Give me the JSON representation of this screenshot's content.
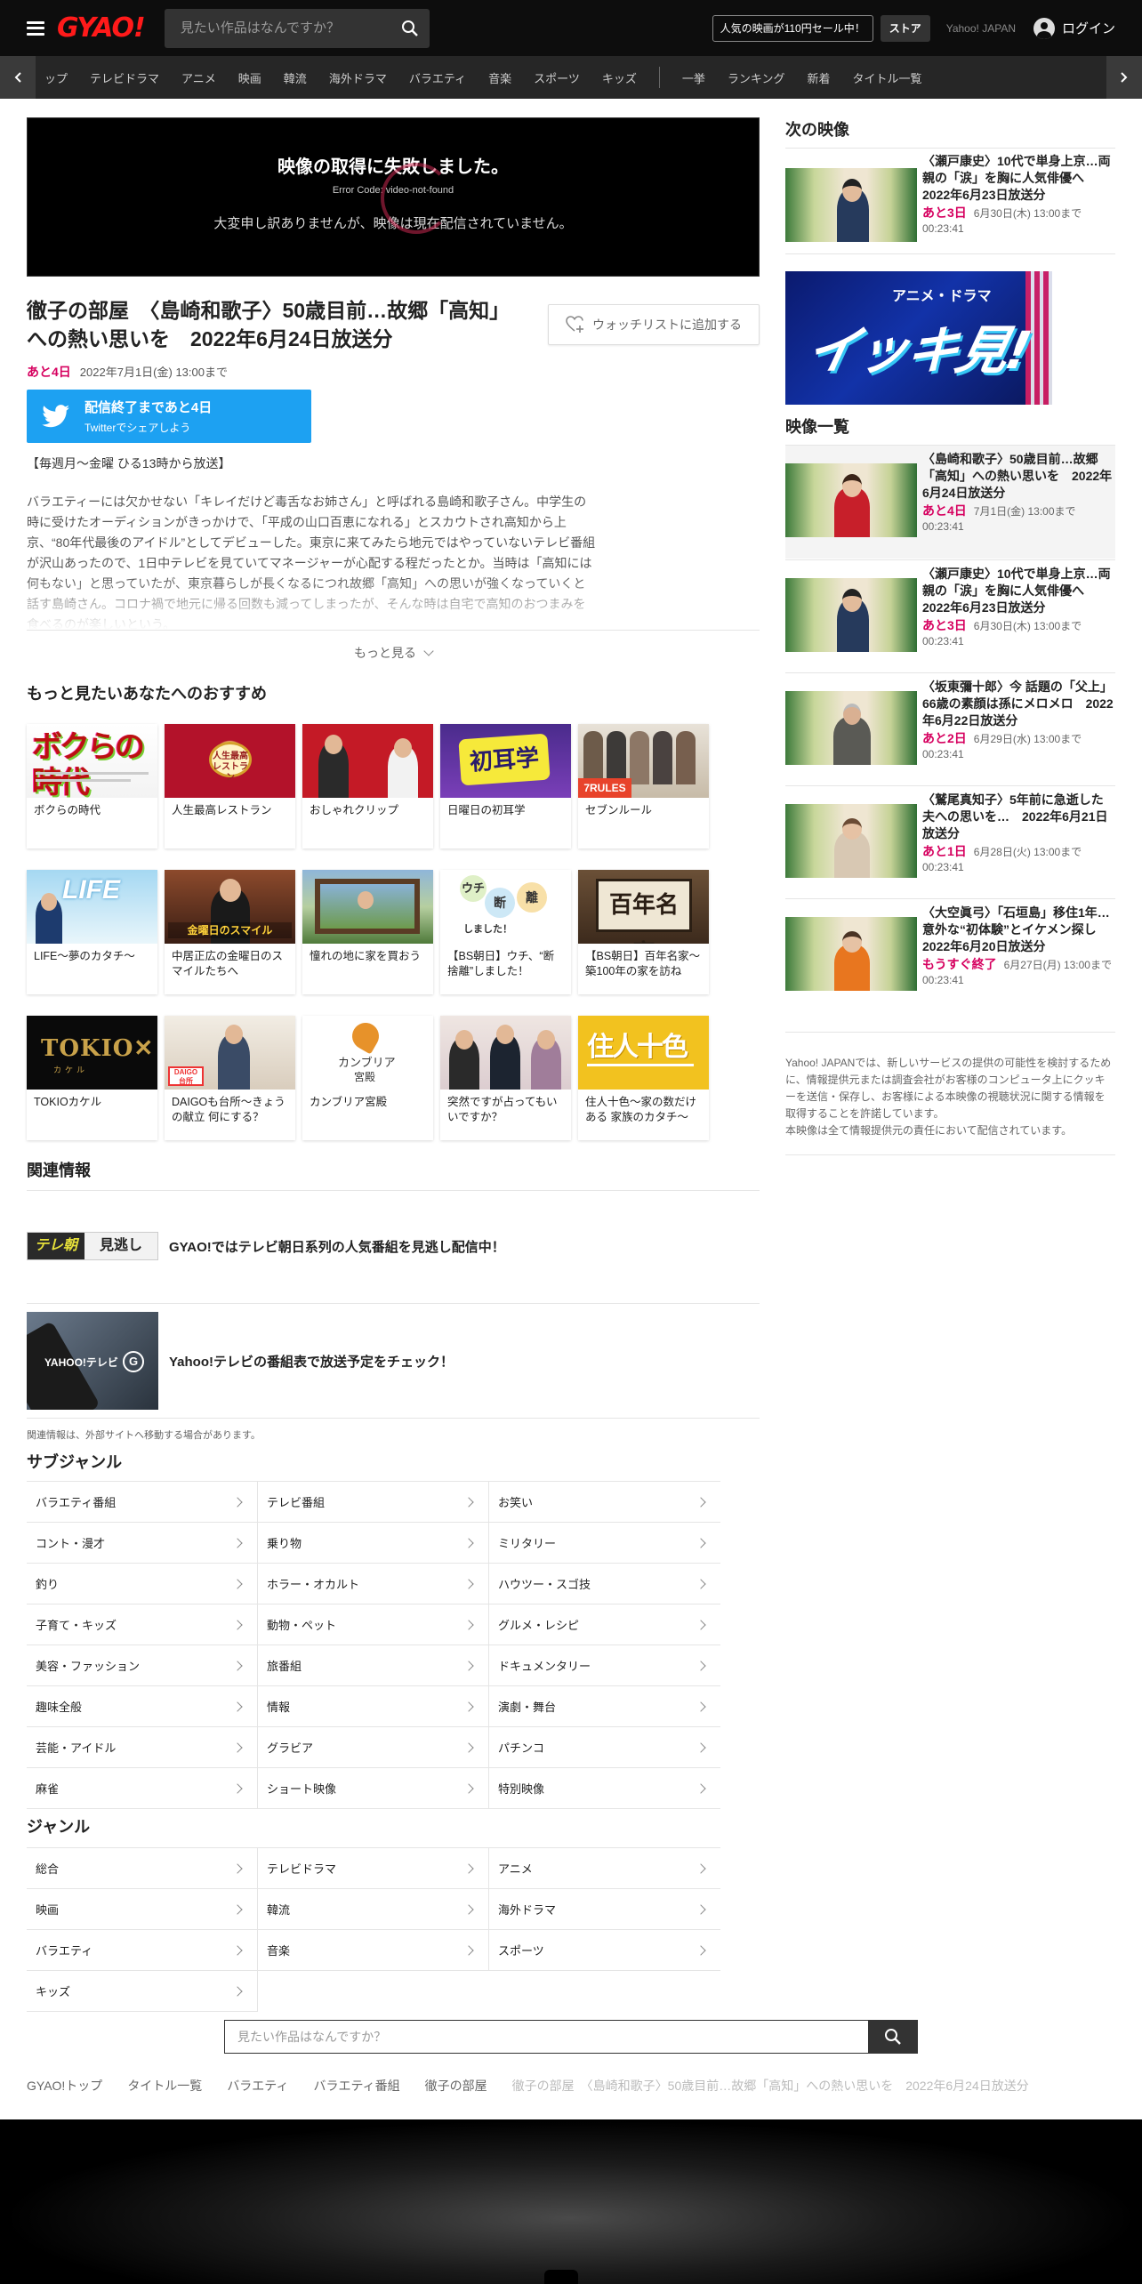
{
  "header": {
    "logo": "GYAO!",
    "search_placeholder": "見たい作品はなんですか？",
    "promo": "人気の映画が110円セール中！",
    "store": "ストア",
    "yahoo": "Yahoo! JAPAN",
    "login": "ログイン"
  },
  "nav": [
    "ップ",
    "テレビドラマ",
    "アニメ",
    "映画",
    "韓流",
    "海外ドラマ",
    "バラエティ",
    "音楽",
    "スポーツ",
    "キッズ",
    "一挙",
    "ランキング",
    "新着",
    "タイトル一覧"
  ],
  "player": {
    "error_title": "映像の取得に失敗しました。",
    "error_code": "Error Code: video-not-found",
    "error_message": "大変申し訳ありませんが、映像は現在配信されていません。"
  },
  "episode": {
    "title": "徹子の部屋　〈島崎和歌子〉50歳目前…故郷「高知」への熱い思いを　2022年6月24日放送分",
    "watchlist": "ウォッチリストに追加する",
    "remaining": "あと4日",
    "deadline": "2022年7月1日(金) 13:00まで",
    "twitter_main": "配信終了まであと4日",
    "twitter_sub": "Twitterでシェアしよう",
    "broadcast": "【毎週月～金曜 ひる13時から放送】",
    "description": "バラエティーには欠かせない「キレイだけど毒舌なお姉さん」と呼ばれる島崎和歌子さん。中学生の時に受けたオーディションがきっかけで、「平成の山口百恵になれる」とスカウトされ高知から上京、“80年代最後のアイドル”としてデビューした。東京に来てみたら地元ではやっていないテレビ番組が沢山あったので、1日中テレビを見ていてマネージャーが心配する程だったとか。当時は「高知には何もない」と思っていたが、東京暮らしが長くなるにつれ故郷「高知」への思いが強くなっていくと話す島崎さん。コロナ禍で地元に帰る回数も減ってしまったが、そんな時は自宅で高知のおつまみを食べるのが楽しいという。",
    "more": "もっと見る"
  },
  "recommend": {
    "heading": "もっと見たいあなたへのおすすめ",
    "items": [
      {
        "label": "ボクらの時代"
      },
      {
        "label": "人生最高レストラン"
      },
      {
        "label": "おしゃれクリップ"
      },
      {
        "label": "日曜日の初耳学"
      },
      {
        "label": "セブンルール"
      },
      {
        "label": "LIFE～夢のカタチ～"
      },
      {
        "label": "中居正広の金曜日のスマイルたちへ"
      },
      {
        "label": "憧れの地に家を買おう"
      },
      {
        "label": "【BS朝日】ウチ、“断捨離”しました！"
      },
      {
        "label": "【BS朝日】百年名家～築100年の家を訪ね"
      },
      {
        "label": "TOKIOカケル"
      },
      {
        "label": "DAIGOも台所～きょうの献立 何にする？"
      },
      {
        "label": "カンブリア宮殿"
      },
      {
        "label": "突然ですが占ってもいいですか？"
      },
      {
        "label": "住人十色～家の数だけある 家族のカタチ～"
      }
    ]
  },
  "related": {
    "heading": "関連情報",
    "items": [
      {
        "text": "GYAO!ではテレビ朝日系列の人気番組を見逃し配信中！",
        "badge": "テレ朝",
        "badge2": "見逃し"
      },
      {
        "text": "Yahoo!テレビの番組表で放送予定をチェック！",
        "badge": "YAHOO!テレビ",
        "badge2": "G"
      }
    ],
    "note": "関連情報は、外部サイトへ移動する場合があります。"
  },
  "subgenre": {
    "heading": "サブジャンル",
    "items": [
      "バラエティ番組",
      "テレビ番組",
      "お笑い",
      "コント・漫才",
      "乗り物",
      "ミリタリー",
      "釣り",
      "ホラー・オカルト",
      "ハウツー・スゴ技",
      "子育て・キッズ",
      "動物・ペット",
      "グルメ・レシピ",
      "美容・ファッション",
      "旅番組",
      "ドキュメンタリー",
      "趣味全般",
      "情報",
      "演劇・舞台",
      "芸能・アイドル",
      "グラビア",
      "パチンコ",
      "麻雀",
      "ショート映像",
      "特別映像"
    ]
  },
  "genre": {
    "heading": "ジャンル",
    "items": [
      "総合",
      "テレビドラマ",
      "アニメ",
      "映画",
      "韓流",
      "海外ドラマ",
      "バラエティ",
      "音楽",
      "スポーツ",
      "キッズ"
    ]
  },
  "footer_search_placeholder": "見たい作品はなんですか？",
  "breadcrumbs": [
    "GYAO!トップ",
    "タイトル一覧",
    "バラエティ",
    "バラエティ番組",
    "徹子の部屋",
    "徹子の部屋　〈島崎和歌子〉50歳目前…故郷「高知」への熱い思いを　2022年6月24日放送分"
  ],
  "sidebar": {
    "next_heading": "次の映像",
    "next": {
      "title": "〈瀬戸康史〉10代で単身上京…両親の「涙」を胸に人気俳優へ　2022年6月23日放送分",
      "remaining": "あと3日",
      "deadline": "6月30日(木) 13:00まで",
      "duration": "00:23:41"
    },
    "banner_small": "アニメ・ドラマ",
    "banner_big": "イッキ見!",
    "list_heading": "映像一覧",
    "list": [
      {
        "title": "〈島崎和歌子〉50歳目前…故郷「高知」への熱い思いを　2022年6月24日放送分",
        "remaining": "あと4日",
        "deadline": "7月1日(金) 13:00まで",
        "duration": "00:23:41"
      },
      {
        "title": "〈瀬戸康史〉10代で単身上京…両親の「涙」を胸に人気俳優へ　2022年6月23日放送分",
        "remaining": "あと3日",
        "deadline": "6月30日(木) 13:00まで",
        "duration": "00:23:41"
      },
      {
        "title": "〈坂東彌十郎〉今 話題の「父上」66歳の素顔は孫にメロメロ　2022年6月22日放送分",
        "remaining": "あと2日",
        "deadline": "6月29日(水) 13:00まで",
        "duration": "00:23:41"
      },
      {
        "title": "〈鷲尾真知子〉5年前に急逝した夫への思いを…　2022年6月21日放送分",
        "remaining": "あと1日",
        "deadline": "6月28日(火) 13:00まで",
        "duration": "00:23:41"
      },
      {
        "title": "〈大空眞弓〉「石垣島」移住1年…意外な“初体験”とイケメン探し　2022年6月20日放送分",
        "remaining": "もうすぐ終了",
        "deadline": "6月27日(月) 13:00まで",
        "duration": "00:23:41"
      }
    ],
    "note": "Yahoo! JAPANでは、新しいサービスの提供の可能性を検討するために、情報提供元または調査会社がお客様のコンピュータ上にクッキーを送信・保存し、お客様による本映像の視聴状況に関する情報を取得することを許諾しています。\n本映像は全て情報提供元の責任において配信されています。"
  }
}
